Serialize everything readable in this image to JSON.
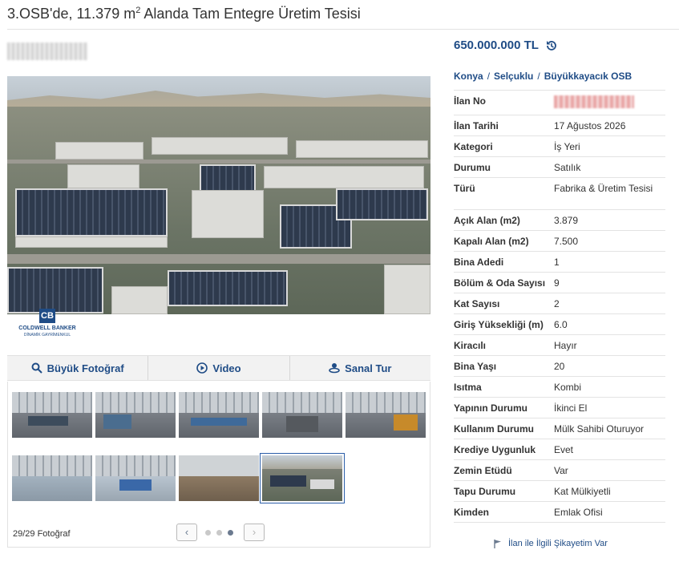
{
  "header": {
    "title": "3.OSB'de, 11.379 m",
    "title_sup": "2",
    "title_rest": " Alanda Tam Entegre Üretim Tesisi"
  },
  "gallery": {
    "watermark_name": "COLDWELL BANKER",
    "watermark_sub": "DİNAMİK GAYRİMENKUL",
    "buttons": [
      "Büyük Fotoğraf",
      "Video",
      "Sanal Tur"
    ],
    "photo_count": "29/29 Fotoğraf",
    "pager": {
      "prev": "‹",
      "next": "›"
    }
  },
  "listing": {
    "price": "650.000.000 TL",
    "location": [
      "Konya",
      "Selçuklu",
      "Büyükkayacık OSB"
    ],
    "details": [
      {
        "label": "İlan No",
        "value": ""
      },
      {
        "label": "İlan Tarihi",
        "value": "17 Ağustos 2026"
      },
      {
        "label": "Kategori",
        "value": "İş Yeri"
      },
      {
        "label": "Durumu",
        "value": "Satılık"
      },
      {
        "label": "Türü",
        "value": "Fabrika & Üretim Tesisi"
      },
      {
        "label": "Açık Alan (m2)",
        "value": "3.879"
      },
      {
        "label": "Kapalı Alan (m2)",
        "value": "7.500"
      },
      {
        "label": "Bina Adedi",
        "value": "1"
      },
      {
        "label": "Bölüm & Oda Sayısı",
        "value": "9"
      },
      {
        "label": "Kat Sayısı",
        "value": "2"
      },
      {
        "label": "Giriş Yüksekliği (m)",
        "value": "6.0"
      },
      {
        "label": "Kiracılı",
        "value": "Hayır"
      },
      {
        "label": "Bina Yaşı",
        "value": "20"
      },
      {
        "label": "Isıtma",
        "value": "Kombi"
      },
      {
        "label": "Yapının Durumu",
        "value": "İkinci El"
      },
      {
        "label": "Kullanım Durumu",
        "value": "Mülk Sahibi Oturuyor"
      },
      {
        "label": "Krediye Uygunluk",
        "value": "Evet"
      },
      {
        "label": "Zemin Etüdü",
        "value": "Var"
      },
      {
        "label": "Tapu Durumu",
        "value": "Kat Mülkiyetli"
      },
      {
        "label": "Kimden",
        "value": "Emlak Ofisi"
      }
    ],
    "complaint_link": "İlan ile İlgili Şikayetim Var"
  }
}
